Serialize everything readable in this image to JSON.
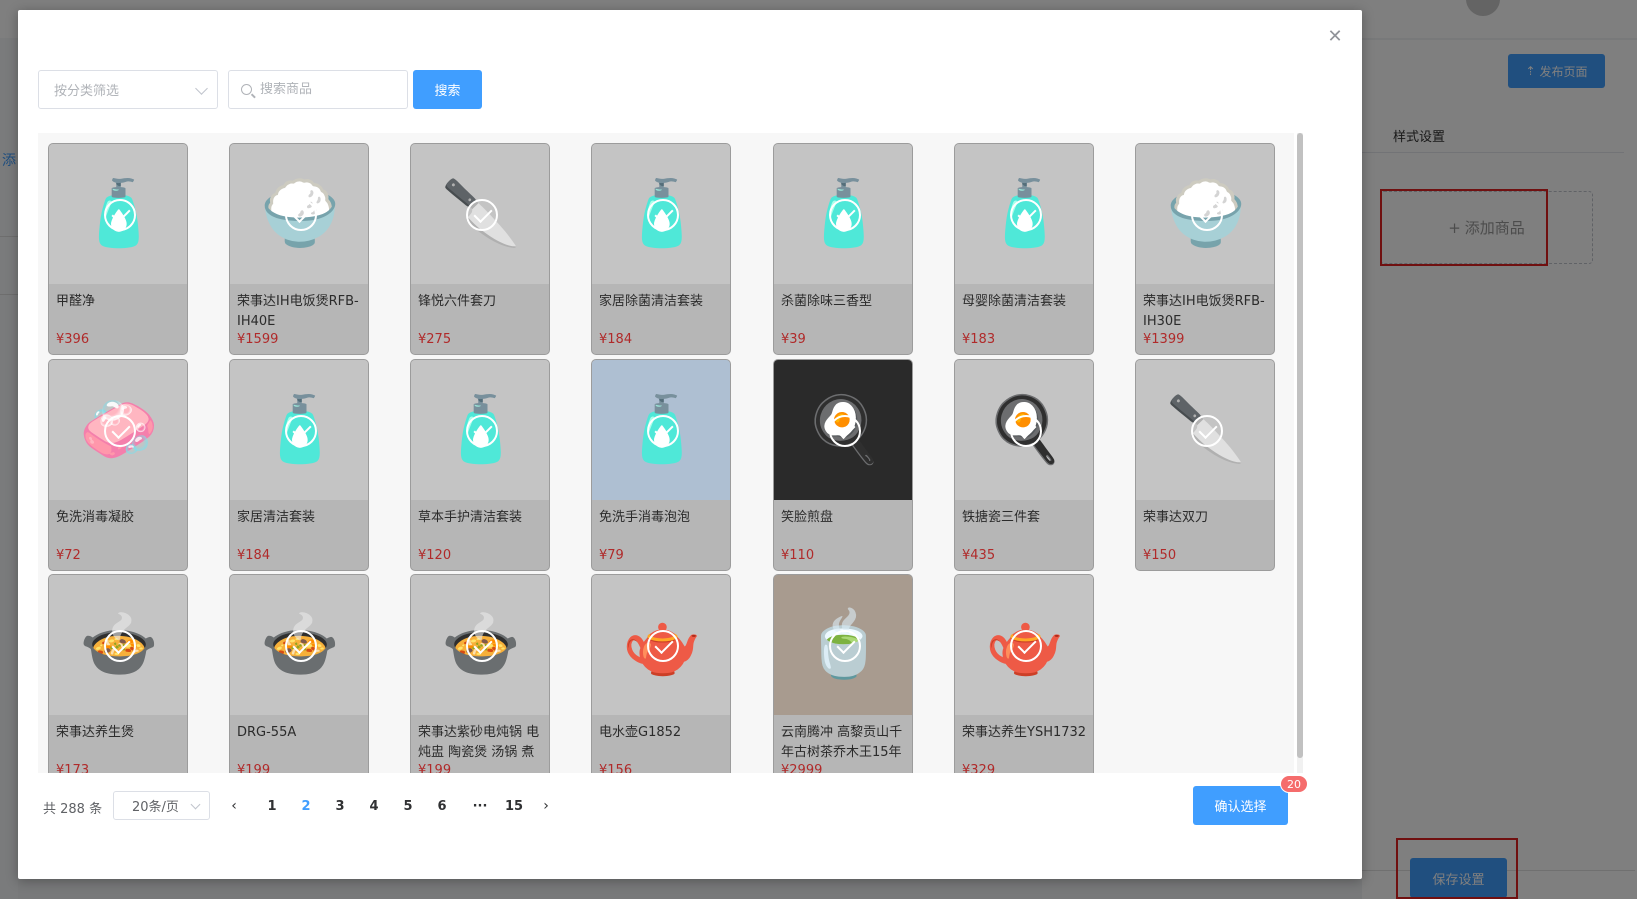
{
  "background": {
    "tab_fragment": "添",
    "publish_label": "发布页面",
    "publish_icon": "upload-icon",
    "style_settings_label": "样式设置",
    "add_goods_label": "添加商品",
    "add_goods_icon": "plus-icon",
    "save_label": "保存设置",
    "highlight_color": "#e02020"
  },
  "dialog": {
    "close_icon": "close-icon",
    "category_placeholder": "按分类筛选",
    "search_placeholder": "搜索商品",
    "search_button": "搜索",
    "products": [
      {
        "name": "甲醛净",
        "price": "¥396",
        "icon": "🧴",
        "bg": "light"
      },
      {
        "name": "荣事达IH电饭煲RFB-IH40E",
        "price": "¥1599",
        "icon": "🍚",
        "bg": "light"
      },
      {
        "name": "锋悦六件套刀",
        "price": "¥275",
        "icon": "🔪",
        "bg": "light"
      },
      {
        "name": "家居除菌清洁套装",
        "price": "¥184",
        "icon": "🧴",
        "bg": "light"
      },
      {
        "name": "杀菌除味三香型",
        "price": "¥39",
        "icon": "🧴",
        "bg": "light"
      },
      {
        "name": "母婴除菌清洁套装",
        "price": "¥183",
        "icon": "🧴",
        "bg": "light"
      },
      {
        "name": "荣事达IH电饭煲RFB-IH30E",
        "price": "¥1399",
        "icon": "🍚",
        "bg": "light"
      },
      {
        "name": "免洗消毒凝胶",
        "price": "¥72",
        "icon": "🧼",
        "bg": "light"
      },
      {
        "name": "家居清洁套装",
        "price": "¥184",
        "icon": "🧴",
        "bg": "light"
      },
      {
        "name": "草本手护清洁套装",
        "price": "¥120",
        "icon": "🧴",
        "bg": "light"
      },
      {
        "name": "免洗手消毒泡泡",
        "price": "¥79",
        "icon": "🧴",
        "bg": "blue"
      },
      {
        "name": "笑脸煎盘",
        "price": "¥110",
        "icon": "🍳",
        "bg": "dark"
      },
      {
        "name": "铁搪瓷三件套",
        "price": "¥435",
        "icon": "🍳",
        "bg": "light"
      },
      {
        "name": "荣事达双刀",
        "price": "¥150",
        "icon": "🔪",
        "bg": "light"
      },
      {
        "name": "荣事达养生煲",
        "price": "¥173",
        "icon": "🍲",
        "bg": "light"
      },
      {
        "name": "DRG-55A",
        "price": "¥199",
        "icon": "🍲",
        "bg": "light"
      },
      {
        "name": "荣事达紫砂电炖锅 电炖盅 陶瓷煲 汤锅 煮",
        "price": "¥199",
        "icon": "🍲",
        "bg": "light"
      },
      {
        "name": "电水壶G1852",
        "price": "¥156",
        "icon": "🫖",
        "bg": "light"
      },
      {
        "name": "云南腾冲 高黎贡山千年古树茶乔木王15年",
        "price": "¥2999",
        "icon": "🍵",
        "bg": "tea"
      },
      {
        "name": "荣事达养生YSH1732",
        "price": "¥329",
        "icon": "🫖",
        "bg": "light"
      }
    ],
    "footer": {
      "total": "共 288 条",
      "page_size": "20条/页",
      "prev_icon": "chevron-left-icon",
      "next_icon": "chevron-right-icon",
      "pages": [
        "1",
        "2",
        "3",
        "4",
        "5",
        "6",
        "···",
        "15"
      ],
      "current_page": "2",
      "confirm_label": "确认选择",
      "selected_count": "20"
    }
  }
}
